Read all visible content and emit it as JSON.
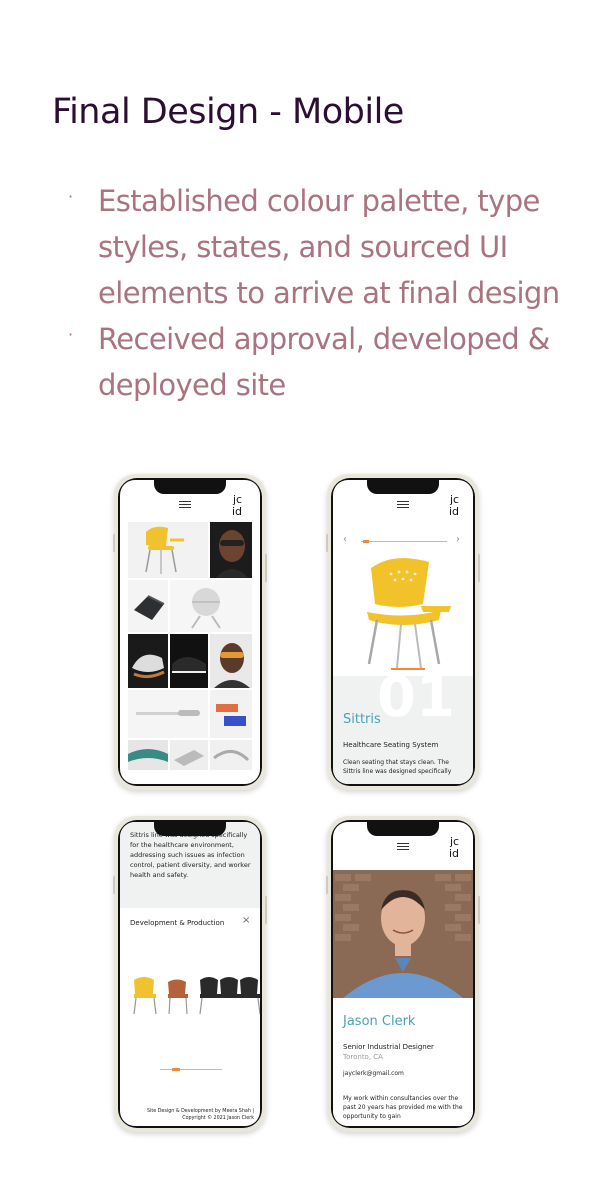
{
  "title": "Final Design - Mobile",
  "bullets": [
    "Established colour palette, type styles, states, and sourced UI elements to arrive at final design",
    "Received approval, developed & deployed site"
  ],
  "bullet_marker": "·",
  "colors": {
    "title": "#2b0f33",
    "bullet": "#a9737f",
    "accent_teal": "#4aa0b6",
    "accent_orange": "#f0893a"
  },
  "logo": {
    "line1": "jc",
    "line2": "id"
  },
  "phone2": {
    "product_name": "Sittris",
    "big_number": "01",
    "subtitle": "Healthcare Seating System",
    "description": "Clean seating that stays clean. The Sittris line was designed specifically"
  },
  "phone3": {
    "body_text": "Sittris line was designed specifically for the healthcare environment, addressing such issues as infection control, patient diversity, and worker health and safety.",
    "section_title": "Development & Production",
    "footer_line1": "Site Design & Development by Meera Shah |",
    "footer_line2": "Copyright © 2021 Jason Clerk"
  },
  "phone4": {
    "name": "Jason Clerk",
    "role": "Senior Industrial Designer",
    "location": "Toronto, CA",
    "email": "jayclerk@gmail.com",
    "bio": "My work within consultancies over the past 20 years has provided me with the opportunity to gain"
  },
  "icons": {
    "menu": "hamburger-menu-icon",
    "prev": "chevron-left-icon",
    "next": "chevron-right-icon",
    "close": "close-icon"
  }
}
